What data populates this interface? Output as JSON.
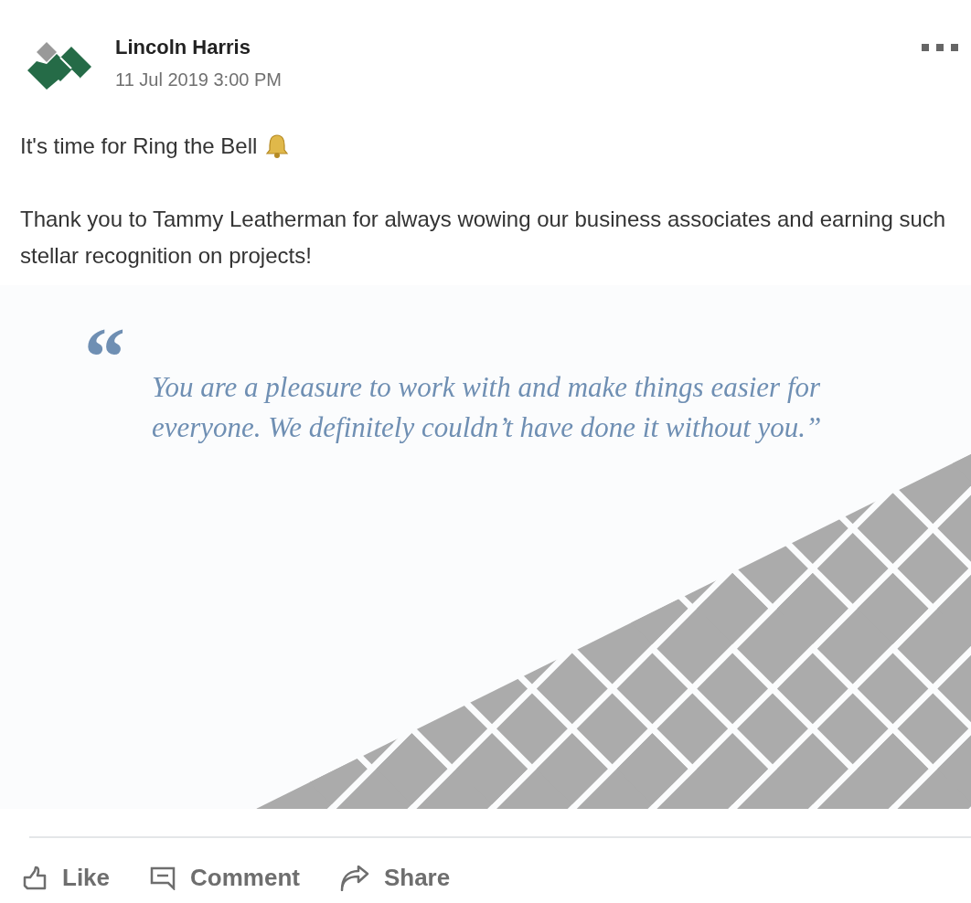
{
  "post": {
    "author": "Lincoln Harris",
    "timestamp": "11 Jul 2019 3:00 PM",
    "paragraphs": [
      {
        "text": "It's time for Ring the Bell",
        "kind": "with_bell"
      },
      {
        "kind": "plain",
        "text": "Thank you to Tammy Leatherman for always wowing our business associates and earning such stellar recognition on projects!"
      }
    ],
    "image": {
      "quote_mark": "“",
      "quote": "You are a pleasure to work with and make things easier for everyone. We definitely couldn’t have done it without you.”"
    }
  },
  "actions": [
    {
      "kind": "like",
      "label": "Like"
    },
    {
      "kind": "comment",
      "label": "Comment"
    },
    {
      "kind": "share",
      "label": "Share"
    }
  ]
}
